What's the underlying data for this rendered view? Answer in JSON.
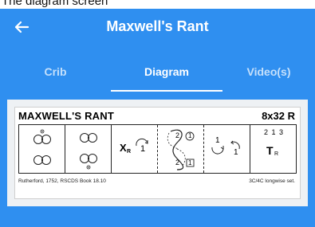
{
  "caption": "The diagram screen",
  "header": {
    "title": "Maxwell's Rant",
    "back_icon": "arrow-left-icon"
  },
  "tabs": [
    {
      "label": "Crib",
      "active": false
    },
    {
      "label": "Diagram",
      "active": true
    },
    {
      "label": "Video(s)",
      "active": false
    }
  ],
  "diagram": {
    "title": "MAXWELL'S RANT",
    "bars": "8x32 R",
    "cells": {
      "figure3": {
        "x": "X",
        "r": "R",
        "bar": "1"
      },
      "figure4": {
        "num_top": "2",
        "circ": "1",
        "num_bottom": "2",
        "box": "1"
      },
      "figure5": {
        "bar_left": "1",
        "bar_right": "1"
      },
      "figure6": {
        "order": "2 1 3",
        "t": "T",
        "r": "R"
      }
    },
    "source": "Rutherford, 1752, RSCDS Book 18.10",
    "set": "3C/4C longwise set."
  },
  "colors": {
    "primary": "#2f8ff0",
    "panel": "#eef1f4"
  }
}
